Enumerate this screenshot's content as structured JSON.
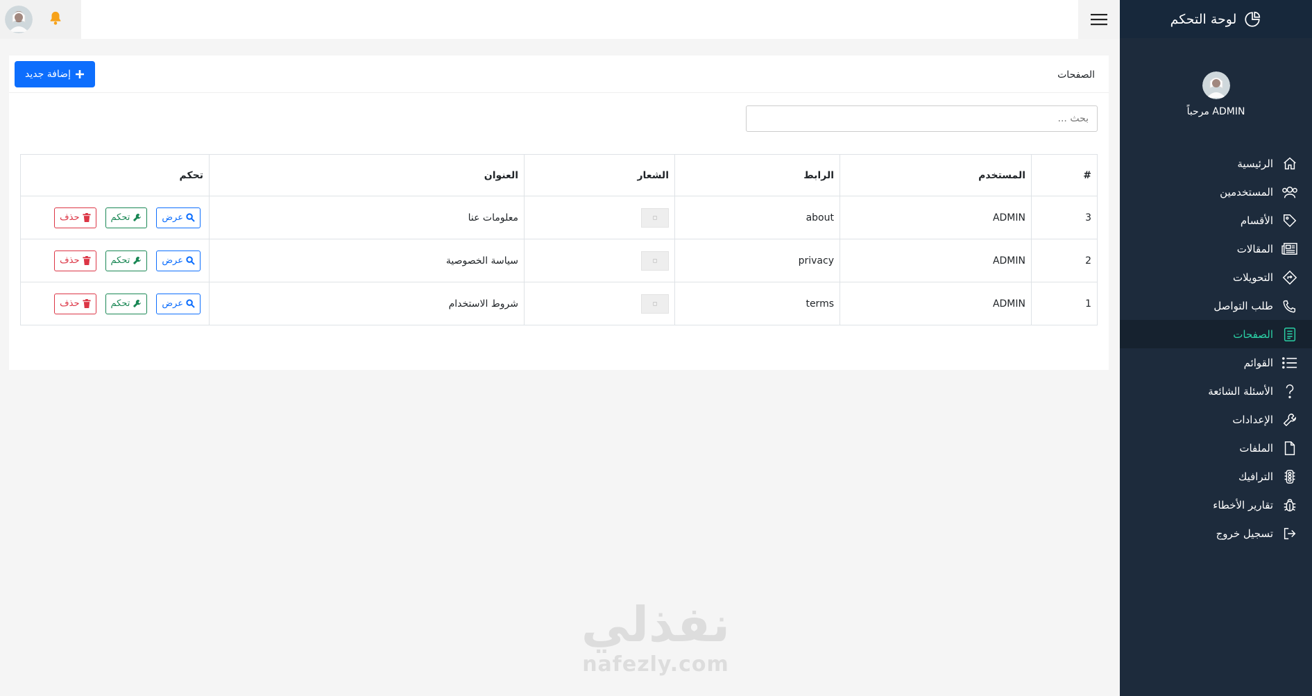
{
  "sidebar": {
    "brand": "لوحة التحكم",
    "welcome": "مرحباً ADMIN",
    "items": [
      {
        "label": "الرئيسية",
        "icon": "home-icon"
      },
      {
        "label": "المستخدمين",
        "icon": "users-icon"
      },
      {
        "label": "الأقسام",
        "icon": "tag-icon"
      },
      {
        "label": "المقالات",
        "icon": "newspaper-icon"
      },
      {
        "label": "التحويلات",
        "icon": "directions-icon"
      },
      {
        "label": "طلب التواصل",
        "icon": "phone-icon"
      },
      {
        "label": "الصفحات",
        "icon": "page-icon"
      },
      {
        "label": "القوائم",
        "icon": "list-icon"
      },
      {
        "label": "الأسئلة الشائعة",
        "icon": "question-icon"
      },
      {
        "label": "الإعدادات",
        "icon": "wrench-icon"
      },
      {
        "label": "الملفات",
        "icon": "file-icon"
      },
      {
        "label": "الترافيك",
        "icon": "traffic-icon"
      },
      {
        "label": "تقارير الأخطاء",
        "icon": "bug-icon"
      },
      {
        "label": "تسجيل خروج",
        "icon": "logout-icon"
      }
    ]
  },
  "card": {
    "title": "الصفحات",
    "add_label": "إضافة جديد",
    "search_placeholder": "بحث ..."
  },
  "table": {
    "headers": [
      "#",
      "المستخدم",
      "الرابط",
      "الشعار",
      "العنوان",
      "تحكم"
    ],
    "rows": [
      {
        "id": "3",
        "user": "ADMIN",
        "link": "about",
        "title": "معلومات عنا"
      },
      {
        "id": "2",
        "user": "ADMIN",
        "link": "privacy",
        "title": "سياسة الخصوصية"
      },
      {
        "id": "1",
        "user": "ADMIN",
        "link": "terms",
        "title": "شروط الاستخدام"
      }
    ],
    "actions": {
      "view": "عرض",
      "edit": "تحكم",
      "delete": "حذف"
    }
  },
  "watermark": {
    "ar": "نفذلي",
    "en": "nafezly.com"
  },
  "colors": {
    "sidebar": "#1d2b3c",
    "active": "#2bd2a6",
    "primary": "#0d6efd",
    "success": "#198754",
    "danger": "#dc3545",
    "bell": "#f7a21a"
  }
}
